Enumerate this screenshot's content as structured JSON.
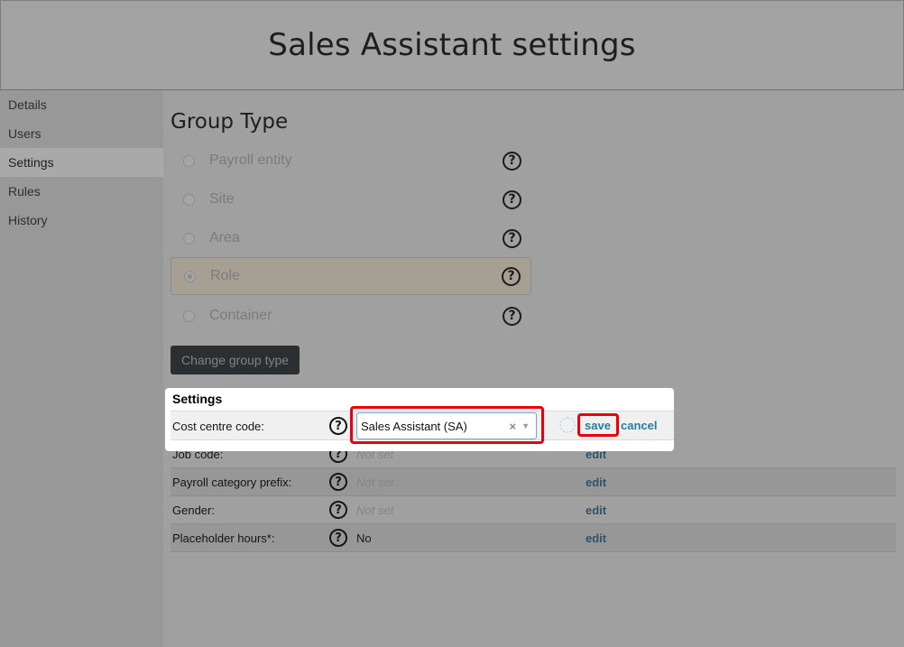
{
  "header": {
    "title": "Sales Assistant settings"
  },
  "sidebar": {
    "items": [
      {
        "label": "Details"
      },
      {
        "label": "Users"
      },
      {
        "label": "Settings"
      },
      {
        "label": "Rules"
      },
      {
        "label": "History"
      }
    ],
    "active": "Settings"
  },
  "group_type": {
    "title": "Group Type",
    "options": [
      {
        "label": "Payroll entity",
        "checked": false
      },
      {
        "label": "Site",
        "checked": false
      },
      {
        "label": "Area",
        "checked": false
      },
      {
        "label": "Role",
        "checked": true
      },
      {
        "label": "Container",
        "checked": false
      }
    ],
    "help_glyph": "?",
    "change_button": "Change group type"
  },
  "settings": {
    "title": "Settings",
    "cost_centre": {
      "label": "Cost centre code:",
      "selected": "Sales Assistant (SA)",
      "clear_glyph": "×",
      "caret_glyph": "▼",
      "save": "save",
      "cancel": "cancel"
    },
    "rows": [
      {
        "label": "Job code:",
        "value": "Not set",
        "edit": "edit"
      },
      {
        "label": "Payroll category prefix:",
        "value": "Not set",
        "edit": "edit"
      },
      {
        "label": "Gender:",
        "value": "Not set",
        "edit": "edit"
      },
      {
        "label": "Placeholder hours*:",
        "value": "No",
        "edit": "edit"
      }
    ]
  },
  "colors": {
    "highlight": "#e8000b",
    "link": "#2c7a9d",
    "button_bg": "#2b2f31"
  }
}
